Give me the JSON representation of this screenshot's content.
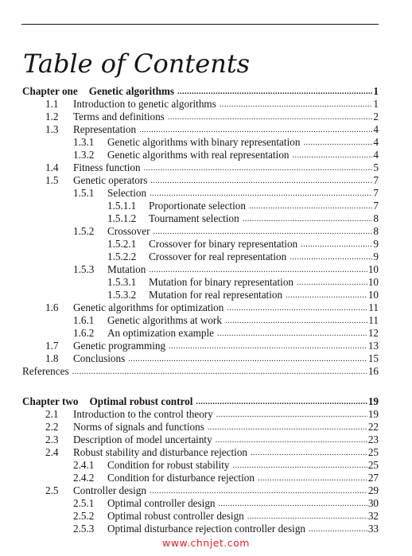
{
  "page": {
    "title": "Table of Contents",
    "watermark": "www.chnjet.com"
  },
  "toc": [
    {
      "level": "chapter",
      "num": "Chapter one",
      "title": "Genetic algorithms",
      "page": "1"
    },
    {
      "level": "l1",
      "num": "1.1",
      "title": "Introduction to genetic algorithms",
      "page": "1"
    },
    {
      "level": "l1",
      "num": "1.2",
      "title": "Terms and definitions",
      "page": "2"
    },
    {
      "level": "l1",
      "num": "1.3",
      "title": "Representation",
      "page": "4"
    },
    {
      "level": "l2",
      "num": "1.3.1",
      "title": "Genetic algorithms with binary representation",
      "page": "4"
    },
    {
      "level": "l2",
      "num": "1.3.2",
      "title": "Genetic algorithms with real representation",
      "page": "4"
    },
    {
      "level": "l1",
      "num": "1.4",
      "title": "Fitness function",
      "page": "5"
    },
    {
      "level": "l1",
      "num": "1.5",
      "title": "Genetic operators",
      "page": "7"
    },
    {
      "level": "l2",
      "num": "1.5.1",
      "title": "Selection",
      "page": "7"
    },
    {
      "level": "l3",
      "num": "1.5.1.1",
      "title": "Proportionate selection",
      "page": "7"
    },
    {
      "level": "l3",
      "num": "1.5.1.2",
      "title": "Tournament selection",
      "page": "8"
    },
    {
      "level": "l2",
      "num": "1.5.2",
      "title": "Crossover",
      "page": "8"
    },
    {
      "level": "l3",
      "num": "1.5.2.1",
      "title": "Crossover for binary representation",
      "page": "9"
    },
    {
      "level": "l3",
      "num": "1.5.2.2",
      "title": "Crossover for real representation",
      "page": "9"
    },
    {
      "level": "l2",
      "num": "1.5.3",
      "title": "Mutation",
      "page": "10"
    },
    {
      "level": "l3",
      "num": "1.5.3.1",
      "title": "Mutation for binary representation",
      "page": "10"
    },
    {
      "level": "l3",
      "num": "1.5.3.2",
      "title": "Mutation for real representation",
      "page": "10"
    },
    {
      "level": "l1",
      "num": "1.6",
      "title": "Genetic algorithms for optimization",
      "page": "11"
    },
    {
      "level": "l2",
      "num": "1.6.1",
      "title": "Genetic algorithms at work",
      "page": "11"
    },
    {
      "level": "l2",
      "num": "1.6.2",
      "title": "An optimization example",
      "page": "12"
    },
    {
      "level": "l1",
      "num": "1.7",
      "title": "Genetic programming",
      "page": "13"
    },
    {
      "level": "l1",
      "num": "1.8",
      "title": "Conclusions",
      "page": "15"
    },
    {
      "level": "l0",
      "num": "",
      "title": "References",
      "page": "16"
    },
    {
      "level": "chapter",
      "num": "Chapter two",
      "title": "Optimal robust control",
      "page": "19",
      "gap": true
    },
    {
      "level": "l1",
      "num": "2.1",
      "title": "Introduction to the control theory",
      "page": "19"
    },
    {
      "level": "l1",
      "num": "2.2",
      "title": "Norms of signals and functions",
      "page": "22"
    },
    {
      "level": "l1",
      "num": "2.3",
      "title": "Description of model uncertainty",
      "page": "23"
    },
    {
      "level": "l1",
      "num": "2.4",
      "title": "Robust stability and disturbance rejection",
      "page": "25"
    },
    {
      "level": "l2",
      "num": "2.4.1",
      "title": "Condition for robust stability",
      "page": "25"
    },
    {
      "level": "l2",
      "num": "2.4.2",
      "title": "Condition for disturbance rejection",
      "page": "27"
    },
    {
      "level": "l1",
      "num": "2.5",
      "title": "Controller design",
      "page": "29"
    },
    {
      "level": "l2",
      "num": "2.5.1",
      "title": "Optimal controller design",
      "page": "30"
    },
    {
      "level": "l2",
      "num": "2.5.2",
      "title": "Optimal robust controller design",
      "page": "32"
    },
    {
      "level": "l2",
      "num": "2.5.3",
      "title": "Optimal disturbance rejection controller design",
      "page": "33"
    }
  ]
}
